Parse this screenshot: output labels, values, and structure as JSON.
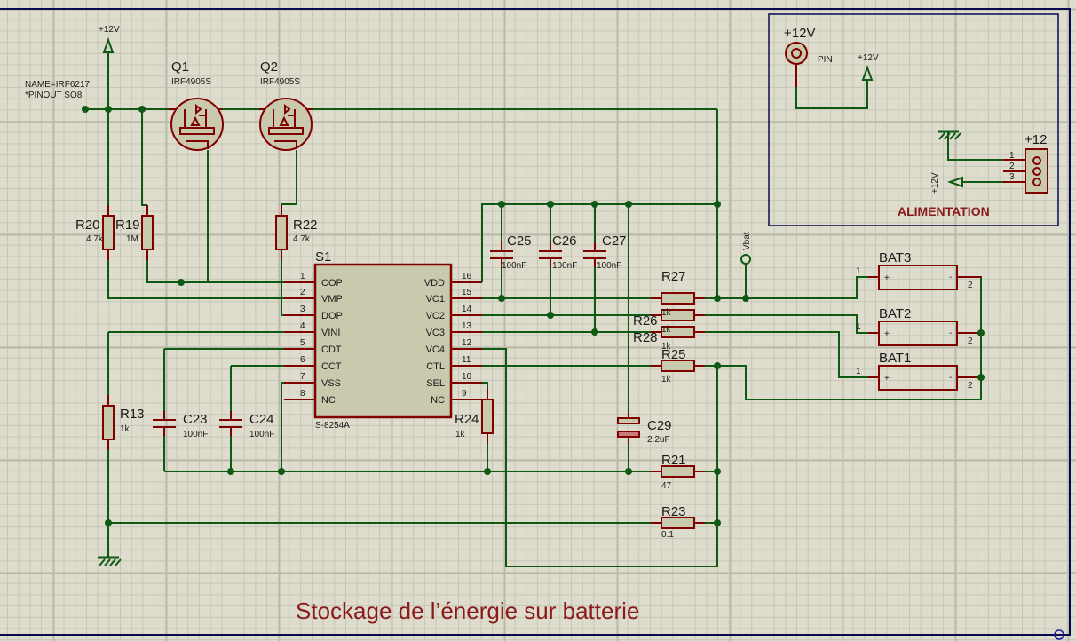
{
  "colors": {
    "background": "#dddccd",
    "wire": "#0e5a12",
    "component": "#800000",
    "component_fill": "#c9c9ad",
    "sheet_border": "#0a0a50",
    "title": "#8b1a1a"
  },
  "title": "Stockage de l’énergie sur batterie",
  "power": {
    "top": "+12V",
    "alim_pin_label": "+12V",
    "alim_pin_type": "PIN",
    "alim_term": "+12V",
    "alim_rot": "+12V"
  },
  "note": {
    "line1": "NAME=IRF6217",
    "line2": "*PINOUT SO8"
  },
  "mosfets": [
    {
      "ref": "Q1",
      "value": "IRF4905S"
    },
    {
      "ref": "Q2",
      "value": "IRF4905S"
    }
  ],
  "ic": {
    "ref": "S1",
    "part": "S-8254A",
    "left_pins": [
      {
        "num": "1",
        "name": "COP"
      },
      {
        "num": "2",
        "name": "VMP"
      },
      {
        "num": "3",
        "name": "DOP"
      },
      {
        "num": "4",
        "name": "VINI"
      },
      {
        "num": "5",
        "name": "CDT"
      },
      {
        "num": "6",
        "name": "CCT"
      },
      {
        "num": "7",
        "name": "VSS"
      },
      {
        "num": "8",
        "name": "NC"
      }
    ],
    "right_pins": [
      {
        "num": "16",
        "name": "VDD"
      },
      {
        "num": "15",
        "name": "VC1"
      },
      {
        "num": "14",
        "name": "VC2"
      },
      {
        "num": "13",
        "name": "VC3"
      },
      {
        "num": "12",
        "name": "VC4"
      },
      {
        "num": "11",
        "name": "CTL"
      },
      {
        "num": "10",
        "name": "SEL"
      },
      {
        "num": "9",
        "name": "NC"
      }
    ]
  },
  "resistors": {
    "R20": {
      "ref": "R20",
      "value": "4.7k"
    },
    "R19": {
      "ref": "R19",
      "value": "1M"
    },
    "R22": {
      "ref": "R22",
      "value": "4.7k"
    },
    "R13": {
      "ref": "R13",
      "value": "1k"
    },
    "R24": {
      "ref": "R24",
      "value": "1k"
    },
    "R27": {
      "ref": "R27",
      "value": "1k"
    },
    "R26": {
      "ref": "R26",
      "value": "1k"
    },
    "R28": {
      "ref": "R28",
      "value": "1k"
    },
    "R25": {
      "ref": "R25",
      "value": "1k"
    },
    "R21": {
      "ref": "R21",
      "value": "47"
    },
    "R23": {
      "ref": "R23",
      "value": "0.1"
    }
  },
  "capacitors": {
    "C23": {
      "ref": "C23",
      "value": "100nF"
    },
    "C24": {
      "ref": "C24",
      "value": "100nF"
    },
    "C25": {
      "ref": "C25",
      "value": "100nF"
    },
    "C26": {
      "ref": "C26",
      "value": "100nF"
    },
    "C27": {
      "ref": "C27",
      "value": "100nF"
    },
    "C29": {
      "ref": "C29",
      "value": "2.2uF"
    }
  },
  "vbat": "Vbat",
  "batteries": [
    {
      "ref": "BAT3",
      "pin1": "1",
      "pin2": "2",
      "plus": "+",
      "minus": "-"
    },
    {
      "ref": "BAT2",
      "pin1": "1",
      "pin2": "2",
      "plus": "+",
      "minus": "-"
    },
    {
      "ref": "BAT1",
      "pin1": "1",
      "pin2": "2",
      "plus": "+",
      "minus": "-"
    }
  ],
  "connector": {
    "ref": "+12",
    "pins": [
      "1",
      "2",
      "3"
    ]
  },
  "alimentation_label": "ALIMENTATION"
}
